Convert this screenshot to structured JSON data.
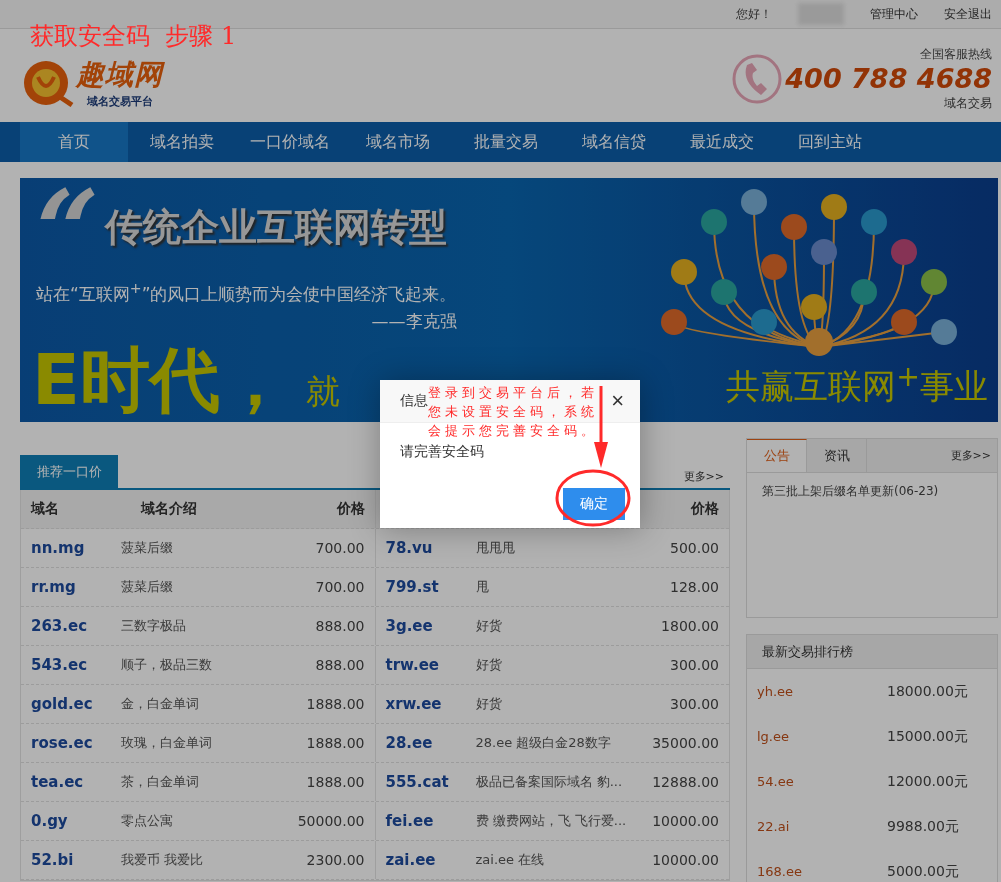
{
  "annotation": {
    "title": "获取安全码  步骤 1",
    "note": "登录到交易平台后，若您未设置安全码，系统会提示您完善安全码。"
  },
  "top_bar": {
    "greeting": "您好！",
    "links": [
      "管理中心",
      "安全退出"
    ]
  },
  "header": {
    "logo_name": "趣域网",
    "logo_tagline": "域名交易平台",
    "hotline_label": "全国客服热线",
    "hotline": "400 788 4688",
    "hotline_sub": "域名交易"
  },
  "nav": [
    {
      "label": "首页",
      "selected": true
    },
    {
      "label": "域名拍卖",
      "selected": false
    },
    {
      "label": "一口价域名",
      "selected": false
    },
    {
      "label": "域名市场",
      "selected": false
    },
    {
      "label": "批量交易",
      "selected": false
    },
    {
      "label": "域名信贷",
      "selected": false
    },
    {
      "label": "最近成交",
      "selected": false
    },
    {
      "label": "回到主站",
      "selected": false
    }
  ],
  "banner": {
    "quote_mark": "“",
    "headline": "传统企业互联网转型",
    "quote": "站在“互联网$^{+}$”的风口上顺势而为会使中国经济飞起来。",
    "attribution": "——李克强",
    "slogan_left": "E时代，",
    "slogan_mid": "就",
    "slogan_right": "共赢互联网$^{+}$事业"
  },
  "recommended": {
    "tab": "推荐一口价",
    "more": "更多>>",
    "headers": [
      {
        "domain": "域名",
        "intro": "域名介绍",
        "price": "价格"
      },
      {
        "price": "价格"
      }
    ],
    "rows": [
      {
        "left": {
          "domain": "nn.mg",
          "intro": "菠菜后缀",
          "price": "700.00"
        },
        "right": {
          "domain": "78.vu",
          "intro": "甩甩甩",
          "price": "500.00"
        }
      },
      {
        "left": {
          "domain": "rr.mg",
          "intro": "菠菜后缀",
          "price": "700.00"
        },
        "right": {
          "domain": "799.st",
          "intro": "甩",
          "price": "128.00"
        }
      },
      {
        "left": {
          "domain": "263.ec",
          "intro": "三数字极品",
          "price": "888.00"
        },
        "right": {
          "domain": "3g.ee",
          "intro": "好货",
          "price": "1800.00"
        }
      },
      {
        "left": {
          "domain": "543.ec",
          "intro": "顺子，极品三数",
          "price": "888.00"
        },
        "right": {
          "domain": "trw.ee",
          "intro": "好货",
          "price": "300.00"
        }
      },
      {
        "left": {
          "domain": "gold.ec",
          "intro": "金，白金单词",
          "price": "1888.00"
        },
        "right": {
          "domain": "xrw.ee",
          "intro": "好货",
          "price": "300.00"
        }
      },
      {
        "left": {
          "domain": "rose.ec",
          "intro": "玫瑰，白金单词",
          "price": "1888.00"
        },
        "right": {
          "domain": "28.ee",
          "intro": "28.ee 超级白金28数字",
          "price": "35000.00"
        }
      },
      {
        "left": {
          "domain": "tea.ec",
          "intro": "茶，白金单词",
          "price": "1888.00"
        },
        "right": {
          "domain": "555.cat",
          "intro": "极品已备案国际域名 豹...",
          "price": "12888.00"
        }
      },
      {
        "left": {
          "domain": "0.gy",
          "intro": "零点公寓",
          "price": "50000.00"
        },
        "right": {
          "domain": "fei.ee",
          "intro": "费 缴费网站，飞 飞行爱...",
          "price": "10000.00"
        }
      },
      {
        "left": {
          "domain": "52.bi",
          "intro": "我爱币 我爱比",
          "price": "2300.00"
        },
        "right": {
          "domain": "zai.ee",
          "intro": "zai.ee 在线",
          "price": "10000.00"
        }
      }
    ]
  },
  "notice": {
    "tabs": [
      {
        "label": "公告",
        "selected": true
      },
      {
        "label": "资讯",
        "selected": false
      }
    ],
    "more": "更多>>",
    "items": [
      "第三批上架后缀名单更新(06-23)"
    ]
  },
  "ranking": {
    "title": "最新交易排行榜",
    "rows": [
      {
        "domain": "yh.ee",
        "price": "18000.00元"
      },
      {
        "domain": "lg.ee",
        "price": "15000.00元"
      },
      {
        "domain": "54.ee",
        "price": "12000.00元"
      },
      {
        "domain": "22.ai",
        "price": "9988.00元"
      },
      {
        "domain": "168.ee",
        "price": "5000.00元"
      }
    ]
  },
  "dialog": {
    "title": "信息",
    "close": "×",
    "message": "请完善安全码",
    "button": "确定"
  }
}
